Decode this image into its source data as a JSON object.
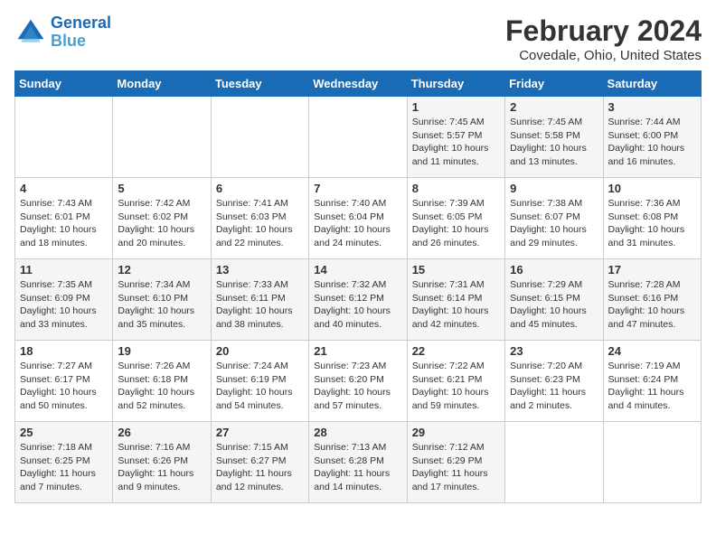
{
  "app": {
    "name": "GeneralBlue",
    "name_part1": "General",
    "name_part2": "Blue"
  },
  "calendar": {
    "title": "February 2024",
    "subtitle": "Covedale, Ohio, United States"
  },
  "headers": [
    "Sunday",
    "Monday",
    "Tuesday",
    "Wednesday",
    "Thursday",
    "Friday",
    "Saturday"
  ],
  "weeks": [
    {
      "days": [
        {
          "num": "",
          "info": ""
        },
        {
          "num": "",
          "info": ""
        },
        {
          "num": "",
          "info": ""
        },
        {
          "num": "",
          "info": ""
        },
        {
          "num": "1",
          "info": "Sunrise: 7:45 AM\nSunset: 5:57 PM\nDaylight: 10 hours\nand 11 minutes."
        },
        {
          "num": "2",
          "info": "Sunrise: 7:45 AM\nSunset: 5:58 PM\nDaylight: 10 hours\nand 13 minutes."
        },
        {
          "num": "3",
          "info": "Sunrise: 7:44 AM\nSunset: 6:00 PM\nDaylight: 10 hours\nand 16 minutes."
        }
      ]
    },
    {
      "days": [
        {
          "num": "4",
          "info": "Sunrise: 7:43 AM\nSunset: 6:01 PM\nDaylight: 10 hours\nand 18 minutes."
        },
        {
          "num": "5",
          "info": "Sunrise: 7:42 AM\nSunset: 6:02 PM\nDaylight: 10 hours\nand 20 minutes."
        },
        {
          "num": "6",
          "info": "Sunrise: 7:41 AM\nSunset: 6:03 PM\nDaylight: 10 hours\nand 22 minutes."
        },
        {
          "num": "7",
          "info": "Sunrise: 7:40 AM\nSunset: 6:04 PM\nDaylight: 10 hours\nand 24 minutes."
        },
        {
          "num": "8",
          "info": "Sunrise: 7:39 AM\nSunset: 6:05 PM\nDaylight: 10 hours\nand 26 minutes."
        },
        {
          "num": "9",
          "info": "Sunrise: 7:38 AM\nSunset: 6:07 PM\nDaylight: 10 hours\nand 29 minutes."
        },
        {
          "num": "10",
          "info": "Sunrise: 7:36 AM\nSunset: 6:08 PM\nDaylight: 10 hours\nand 31 minutes."
        }
      ]
    },
    {
      "days": [
        {
          "num": "11",
          "info": "Sunrise: 7:35 AM\nSunset: 6:09 PM\nDaylight: 10 hours\nand 33 minutes."
        },
        {
          "num": "12",
          "info": "Sunrise: 7:34 AM\nSunset: 6:10 PM\nDaylight: 10 hours\nand 35 minutes."
        },
        {
          "num": "13",
          "info": "Sunrise: 7:33 AM\nSunset: 6:11 PM\nDaylight: 10 hours\nand 38 minutes."
        },
        {
          "num": "14",
          "info": "Sunrise: 7:32 AM\nSunset: 6:12 PM\nDaylight: 10 hours\nand 40 minutes."
        },
        {
          "num": "15",
          "info": "Sunrise: 7:31 AM\nSunset: 6:14 PM\nDaylight: 10 hours\nand 42 minutes."
        },
        {
          "num": "16",
          "info": "Sunrise: 7:29 AM\nSunset: 6:15 PM\nDaylight: 10 hours\nand 45 minutes."
        },
        {
          "num": "17",
          "info": "Sunrise: 7:28 AM\nSunset: 6:16 PM\nDaylight: 10 hours\nand 47 minutes."
        }
      ]
    },
    {
      "days": [
        {
          "num": "18",
          "info": "Sunrise: 7:27 AM\nSunset: 6:17 PM\nDaylight: 10 hours\nand 50 minutes."
        },
        {
          "num": "19",
          "info": "Sunrise: 7:26 AM\nSunset: 6:18 PM\nDaylight: 10 hours\nand 52 minutes."
        },
        {
          "num": "20",
          "info": "Sunrise: 7:24 AM\nSunset: 6:19 PM\nDaylight: 10 hours\nand 54 minutes."
        },
        {
          "num": "21",
          "info": "Sunrise: 7:23 AM\nSunset: 6:20 PM\nDaylight: 10 hours\nand 57 minutes."
        },
        {
          "num": "22",
          "info": "Sunrise: 7:22 AM\nSunset: 6:21 PM\nDaylight: 10 hours\nand 59 minutes."
        },
        {
          "num": "23",
          "info": "Sunrise: 7:20 AM\nSunset: 6:23 PM\nDaylight: 11 hours\nand 2 minutes."
        },
        {
          "num": "24",
          "info": "Sunrise: 7:19 AM\nSunset: 6:24 PM\nDaylight: 11 hours\nand 4 minutes."
        }
      ]
    },
    {
      "days": [
        {
          "num": "25",
          "info": "Sunrise: 7:18 AM\nSunset: 6:25 PM\nDaylight: 11 hours\nand 7 minutes."
        },
        {
          "num": "26",
          "info": "Sunrise: 7:16 AM\nSunset: 6:26 PM\nDaylight: 11 hours\nand 9 minutes."
        },
        {
          "num": "27",
          "info": "Sunrise: 7:15 AM\nSunset: 6:27 PM\nDaylight: 11 hours\nand 12 minutes."
        },
        {
          "num": "28",
          "info": "Sunrise: 7:13 AM\nSunset: 6:28 PM\nDaylight: 11 hours\nand 14 minutes."
        },
        {
          "num": "29",
          "info": "Sunrise: 7:12 AM\nSunset: 6:29 PM\nDaylight: 11 hours\nand 17 minutes."
        },
        {
          "num": "",
          "info": ""
        },
        {
          "num": "",
          "info": ""
        }
      ]
    }
  ]
}
